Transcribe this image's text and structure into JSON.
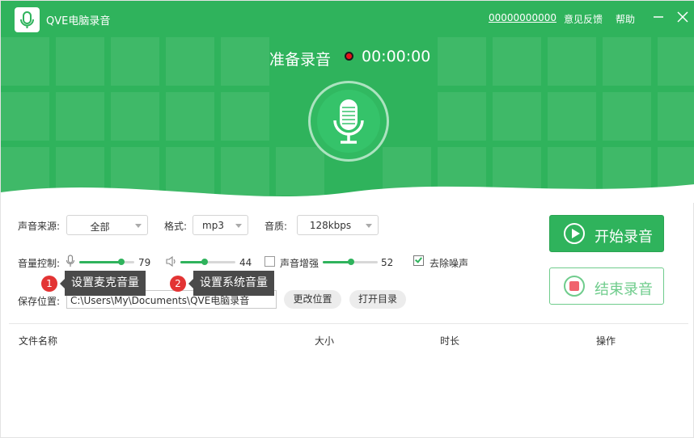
{
  "window": {
    "app_title": "QVE电脑录音",
    "account": "00000000000",
    "feedback": "意见反馈",
    "help": "帮助"
  },
  "recorder": {
    "status": "准备录音",
    "timer": "00:00:00"
  },
  "settings": {
    "source_label": "声音来源:",
    "source_value": "全部",
    "format_label": "格式:",
    "format_value": "mp3",
    "quality_label": "音质:",
    "quality_value": "128kbps",
    "volume_label": "音量控制:",
    "mic_volume": "79",
    "system_volume": "44",
    "enhance_label": "声音增强",
    "enhance_value": "52",
    "denoise_label": "去除噪声",
    "denoise_checked": true,
    "enhance_checked": false,
    "save_label": "保存位置:",
    "save_path": "C:\\Users\\My\\Documents\\QVE电脑录音",
    "change_location": "更改位置",
    "open_folder": "打开目录"
  },
  "tips": {
    "mic_badge": "1",
    "mic_tip": "设置麦克音量",
    "system_badge": "2",
    "system_tip": "设置系统音量"
  },
  "actions": {
    "start": "开始录音",
    "stop": "结束录音"
  },
  "table": {
    "columns": [
      "文件名称",
      "大小",
      "时长",
      "操作"
    ]
  },
  "colors": {
    "brand": "#2fb35c",
    "record_dot": "#e8131a",
    "stop_square": "#f0636d",
    "badge": "#e33434"
  }
}
